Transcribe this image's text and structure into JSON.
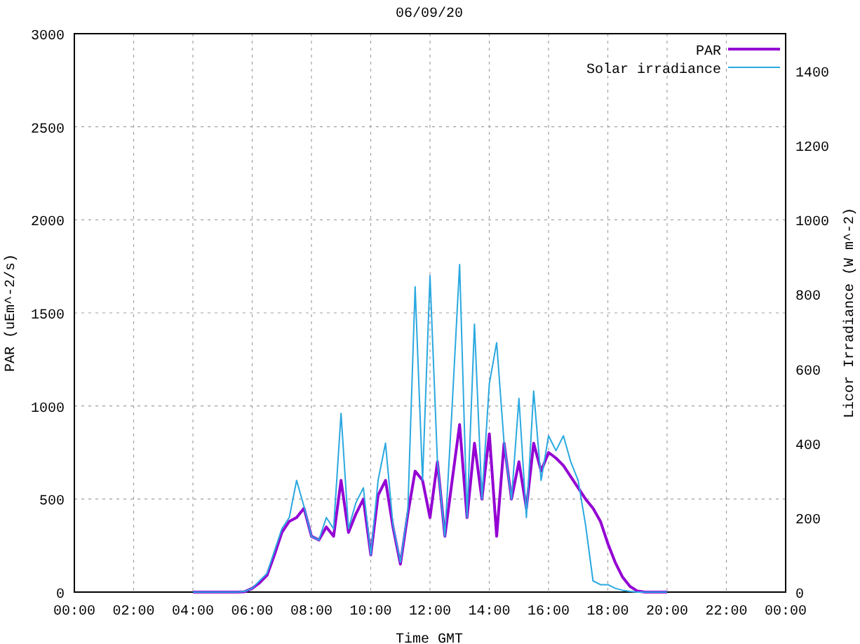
{
  "chart": {
    "chart_data": {
      "type": "line",
      "title": "06/09/20",
      "xlabel": "Time GMT",
      "ylabel": "PAR (uEm^-2/s)",
      "y2label": "Licor Irradiance (W m^-2)",
      "x": [
        4,
        4.25,
        4.5,
        4.75,
        5,
        5.25,
        5.5,
        5.75,
        6,
        6.25,
        6.5,
        6.75,
        7,
        7.25,
        7.5,
        7.75,
        8,
        8.25,
        8.5,
        8.75,
        9,
        9.25,
        9.5,
        9.75,
        10,
        10.25,
        10.5,
        10.75,
        11,
        11.25,
        11.5,
        11.75,
        12,
        12.25,
        12.5,
        12.75,
        13,
        13.25,
        13.5,
        13.75,
        14,
        14.25,
        14.5,
        14.75,
        15,
        15.25,
        15.5,
        15.75,
        16,
        16.25,
        16.5,
        16.75,
        17,
        17.25,
        17.5,
        17.75,
        18,
        18.25,
        18.5,
        18.75,
        19,
        19.25,
        19.5,
        19.75,
        20
      ],
      "series": [
        {
          "name": "PAR",
          "color": "#9400d3",
          "axis": "y",
          "values": [
            0,
            0,
            0,
            0,
            0,
            0,
            0,
            2,
            20,
            50,
            90,
            200,
            320,
            380,
            400,
            450,
            300,
            280,
            350,
            300,
            600,
            320,
            420,
            500,
            200,
            520,
            600,
            350,
            150,
            420,
            650,
            600,
            400,
            700,
            300,
            600,
            900,
            400,
            800,
            500,
            850,
            300,
            800,
            500,
            700,
            450,
            800,
            650,
            750,
            720,
            680,
            620,
            560,
            500,
            450,
            380,
            260,
            160,
            80,
            30,
            5,
            0,
            0,
            0,
            0
          ]
        },
        {
          "name": "Solar irradiance",
          "color": "#2aa8e0",
          "axis": "y2",
          "values": [
            0,
            0,
            0,
            0,
            0,
            0,
            0,
            2,
            10,
            30,
            50,
            110,
            170,
            200,
            300,
            230,
            150,
            140,
            200,
            170,
            480,
            170,
            240,
            280,
            100,
            300,
            400,
            180,
            80,
            220,
            820,
            300,
            850,
            350,
            150,
            500,
            880,
            200,
            720,
            250,
            560,
            670,
            400,
            250,
            520,
            200,
            540,
            300,
            420,
            380,
            420,
            350,
            300,
            180,
            30,
            20,
            20,
            10,
            5,
            2,
            0,
            0,
            0,
            0,
            0
          ]
        }
      ],
      "grid": true,
      "legend": true,
      "xlim": [
        0,
        24
      ],
      "ylim": [
        0,
        3000
      ],
      "y2lim": [
        0,
        1500
      ],
      "xticks": [
        {
          "value": 0,
          "label": "00:00"
        },
        {
          "value": 2,
          "label": "02:00"
        },
        {
          "value": 4,
          "label": "04:00"
        },
        {
          "value": 6,
          "label": "06:00"
        },
        {
          "value": 8,
          "label": "08:00"
        },
        {
          "value": 10,
          "label": "10:00"
        },
        {
          "value": 12,
          "label": "12:00"
        },
        {
          "value": 14,
          "label": "14:00"
        },
        {
          "value": 16,
          "label": "16:00"
        },
        {
          "value": 18,
          "label": "18:00"
        },
        {
          "value": 20,
          "label": "20:00"
        },
        {
          "value": 22,
          "label": "22:00"
        },
        {
          "value": 24,
          "label": "00:00"
        }
      ],
      "yticks": [
        0,
        500,
        1000,
        1500,
        2000,
        2500,
        3000
      ],
      "y2ticks": [
        0,
        200,
        400,
        600,
        800,
        1000,
        1200,
        1400
      ]
    }
  }
}
